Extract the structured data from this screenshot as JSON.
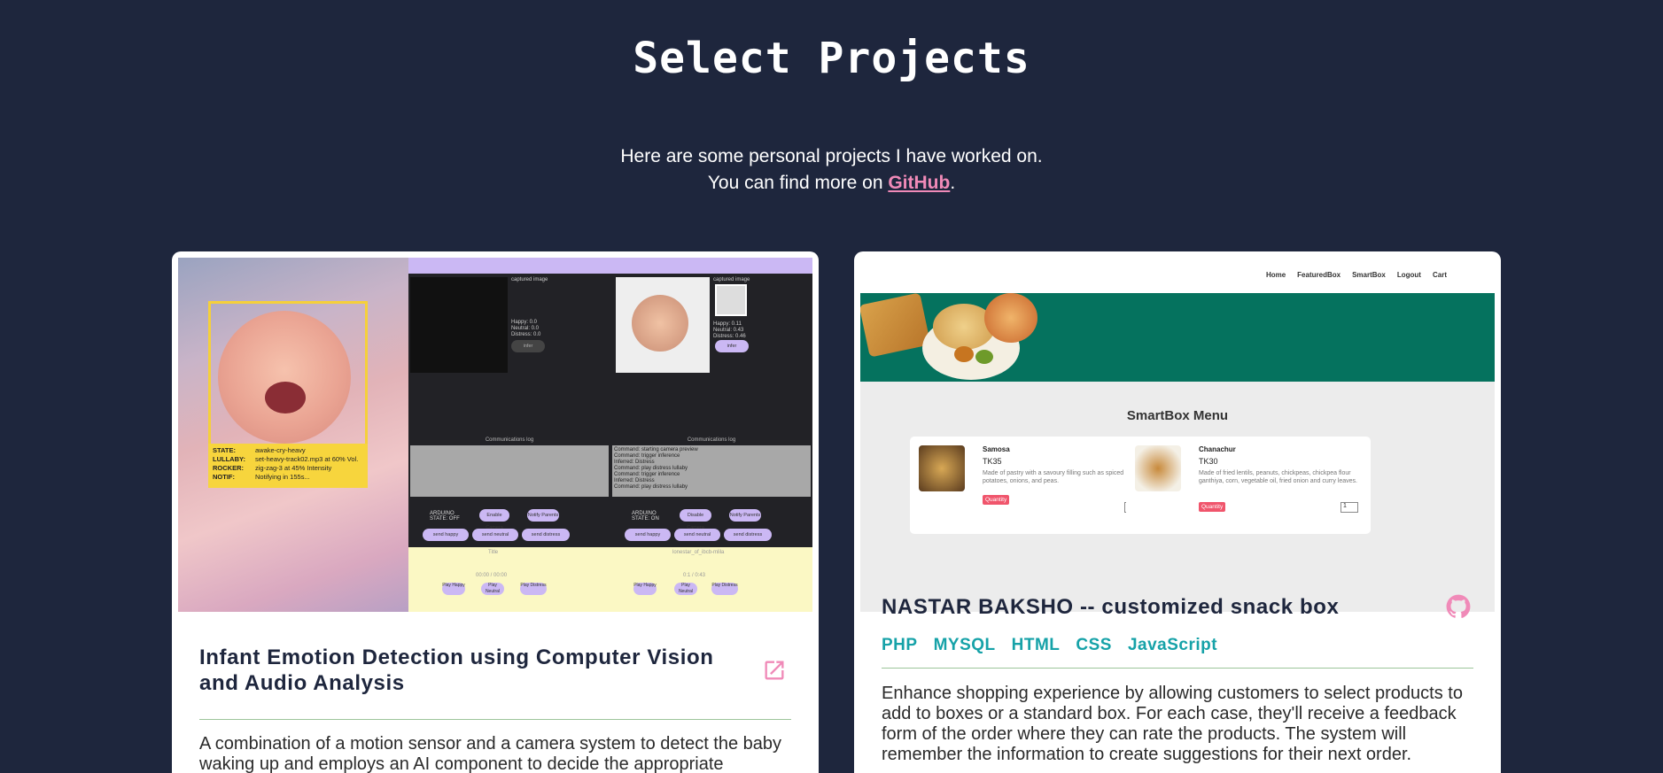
{
  "header": {
    "title": "Select Projects",
    "intro_line1": "Here are some personal projects I have worked on.",
    "intro_line2_prefix": "You can find more on ",
    "intro_link": "GitHub",
    "intro_suffix": "."
  },
  "projects": [
    {
      "title_line1": "Infant Emotion Detection using Computer Vision",
      "title_line2": "and Audio Analysis",
      "link_icon": "external-link-icon",
      "description_line1": "A combination of a motion sensor and a camera system to detect the baby",
      "description_line2": "waking up and employs an AI component to decide the appropriate",
      "screenshot": {
        "state_label": "STATE:",
        "state_value": "awake-cry-heavy",
        "lullaby_label": "LULLABY:",
        "lullaby_value": "set-heavy-track02.mp3 at 60% Vol.",
        "rocker_label": "ROCKER:",
        "rocker_value": "zig-zag-3 at 45% Intensity",
        "notif_label": "NOTIF:",
        "notif_value": "Notifying in 155s...",
        "captured_image": "captured image",
        "left_happy": "Happy: 0.0",
        "left_neutral": "Neutral: 0.0",
        "left_distress": "Distress: 0.0",
        "right_happy": "Happy: 0.11",
        "right_neutral": "Neutral: 0.43",
        "right_distress": "Distress: 0.46",
        "infer": "infer",
        "comm_log": "Communications log",
        "log_lines": [
          "Command: starting camera preview",
          "Command: trigger inference",
          "Inferred: Distress",
          "Command: play distress lullaby",
          "Command: trigger inference",
          "Inferred: Distress",
          "Command: play distress lullaby"
        ],
        "arduino_off": "ARDUINO STATE: OFF",
        "arduino_on": "ARDUINO STATE: ON",
        "enable_camera": "Enable Camera",
        "disable_camera": "Disable Camera",
        "notify_parents": "Notify Parents",
        "send_happy": "send happy",
        "send_neutral": "send neutral",
        "send_distress": "send distress",
        "player_title_left": "Title",
        "player_title_right": "lonestar_of_ibcb-mlila",
        "time_left": "00:00 / 00:00",
        "time_right": "0:1 / 0:43",
        "play_happy": "Play Happy",
        "play_neutral": "Play Neutral",
        "play_distress": "Play Distress"
      }
    },
    {
      "title": "NASTAR BAKSHO -- customized snack box",
      "link_icon": "github-icon",
      "tags": [
        "PHP",
        "MYSQL",
        "HTML",
        "CSS",
        "JavaScript"
      ],
      "description_lines": [
        "Enhance shopping experience by allowing customers to select products to",
        "add to boxes or a standard box. For each case, they'll receive a feedback",
        "form of the order where they can rate the products. The system will",
        "remember the information to create suggestions for their next order."
      ],
      "screenshot": {
        "nav": [
          "Home",
          "FeaturedBox",
          "SmartBox",
          "Logout",
          "Cart"
        ],
        "menu_title": "SmartBox Menu",
        "items": [
          {
            "name": "Samosa",
            "price": "TK35",
            "desc": "Made of pastry with a savoury filling such as spiced potatoes, onions, and peas.",
            "qty_label": "Quantity",
            "qty": "1"
          },
          {
            "name": "Chanachur",
            "price": "TK30",
            "desc": "Made of fried lentils, peanuts, chickpeas, chickpea flour ganthiya, corn, vegetable oil, fried onion and curry leaves.",
            "qty_label": "Quantity",
            "qty": "1"
          }
        ]
      }
    }
  ],
  "colors": {
    "background": "#1e263d",
    "link": "#f08ab8",
    "tag": "#16a2a8",
    "divider": "#9cc59a"
  }
}
